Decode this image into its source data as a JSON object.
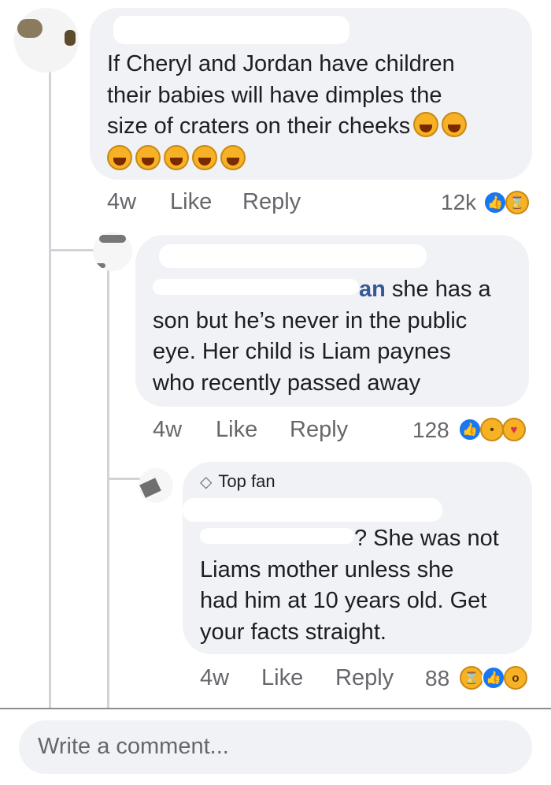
{
  "comments": [
    {
      "text_lines": [
        "If Cheryl and Jordan have children",
        "their babies will have dimples the",
        "size of craters on their cheeks"
      ],
      "inline_emoji": "rolling-on-floor-laughing",
      "time": "4w",
      "like_label": "Like",
      "reply_label": "Reply",
      "reaction_count": "12k",
      "reactions": [
        "like",
        "haha"
      ]
    },
    {
      "mention_visible": "an",
      "text_lines": [
        "she has a",
        "son but he’s never in the public",
        "eye. Her child is Liam paynes",
        "who recently passed away"
      ],
      "time": "4w",
      "like_label": "Like",
      "reply_label": "Reply",
      "reaction_count": "128",
      "reactions": [
        "like",
        "sad",
        "care"
      ]
    },
    {
      "badge": "Top fan",
      "mention_visible": "",
      "text_lines": [
        "? She was not",
        "Liams mother unless she",
        "had him at 10 years old. Get",
        "your facts straight."
      ],
      "time": "4w",
      "like_label": "Like",
      "reply_label": "Reply",
      "reaction_count": "88",
      "reactions": [
        "haha",
        "like",
        "wow"
      ]
    }
  ],
  "composer": {
    "placeholder": "Write a comment..."
  }
}
